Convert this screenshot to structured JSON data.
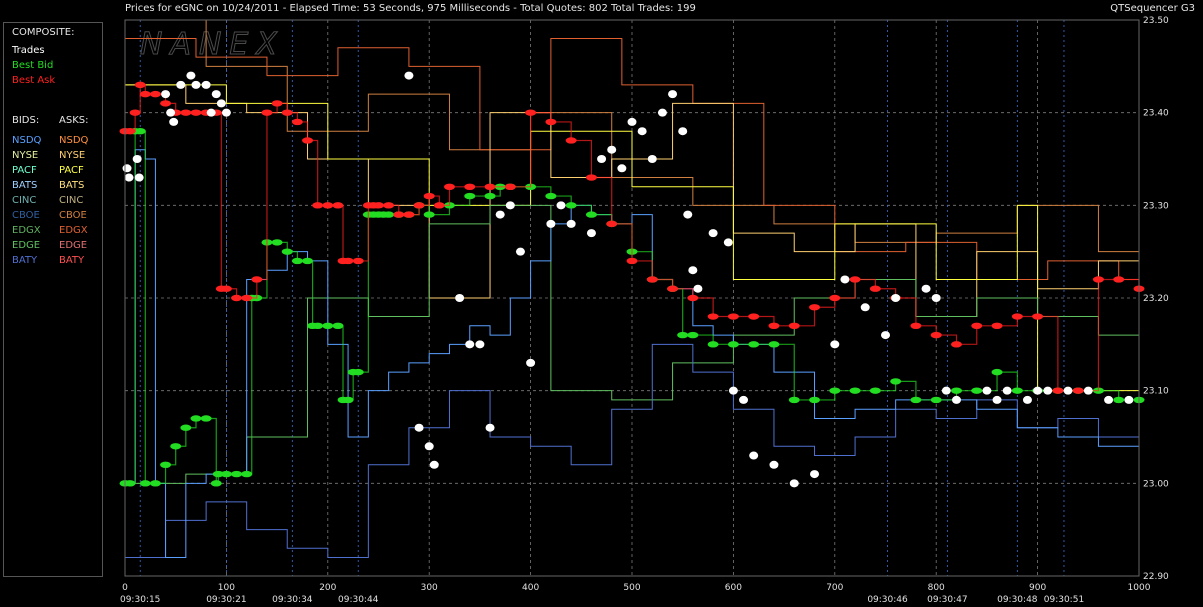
{
  "header": {
    "title": "Prices for  eGNC  on  10/24/2011  -  Elapsed Time: 53 Seconds, 975 Milliseconds  -  Total Quotes: 802  Total Trades: 199",
    "app_name": "QTSequencer G3",
    "watermark": "NANEX"
  },
  "legend": {
    "composite_title": "COMPOSITE:",
    "composite": [
      {
        "label": "Trades",
        "color": "#ffffff"
      },
      {
        "label": "Best Bid",
        "color": "#22dd22"
      },
      {
        "label": "Best Ask",
        "color": "#ff2020"
      }
    ],
    "bids_title": "BIDS:",
    "asks_title": "ASKS:",
    "bids": [
      {
        "label": "NSDQ",
        "color": "#5aa0ff"
      },
      {
        "label": "NYSE",
        "color": "#e0f0a0"
      },
      {
        "label": "PACF",
        "color": "#70ffd0"
      },
      {
        "label": "BATS",
        "color": "#a0d0ff"
      },
      {
        "label": "CINC",
        "color": "#70b0b0"
      },
      {
        "label": "CBOE",
        "color": "#3060a0"
      },
      {
        "label": "EDGX",
        "color": "#60b060"
      },
      {
        "label": "EDGE",
        "color": "#60c060"
      },
      {
        "label": "BATY",
        "color": "#5070d0"
      }
    ],
    "asks": [
      {
        "label": "NSDQ",
        "color": "#ff9040"
      },
      {
        "label": "NYSE",
        "color": "#ffd070"
      },
      {
        "label": "PACF",
        "color": "#ffff40"
      },
      {
        "label": "BATS",
        "color": "#ffe080"
      },
      {
        "label": "CINC",
        "color": "#c0b080"
      },
      {
        "label": "CBOE",
        "color": "#d08040"
      },
      {
        "label": "EDGX",
        "color": "#e06030"
      },
      {
        "label": "EDGE",
        "color": "#e07070"
      },
      {
        "label": "BATY",
        "color": "#ff5050"
      }
    ]
  },
  "chart_data": {
    "type": "line",
    "xlim": [
      0,
      1000
    ],
    "ylim": [
      22.9,
      23.5
    ],
    "x_ticks": [
      0,
      100,
      200,
      300,
      400,
      500,
      600,
      700,
      800,
      900,
      1000
    ],
    "y_ticks": [
      "23.50",
      "23.40",
      "23.30",
      "23.20",
      "23.10",
      "23.00",
      "22.90"
    ],
    "time_labels": [
      {
        "x": 15,
        "label": "09:30:15"
      },
      {
        "x": 100,
        "label": "09:30:21"
      },
      {
        "x": 165,
        "label": "09:30:34"
      },
      {
        "x": 230,
        "label": "09:30:44"
      },
      {
        "x": 752,
        "label": "09:30:46"
      },
      {
        "x": 811,
        "label": "09:30:47"
      },
      {
        "x": 880,
        "label": "09:30:48"
      },
      {
        "x": 926,
        "label": "09:30:51"
      }
    ],
    "series": [
      {
        "name": "Best Bid",
        "x": [
          0,
          5,
          10,
          15,
          20,
          30,
          40,
          50,
          60,
          70,
          80,
          90,
          92,
          100,
          110,
          120,
          125,
          130,
          140,
          150,
          160,
          170,
          180,
          185,
          190,
          200,
          210,
          215,
          220,
          225,
          230,
          240,
          245,
          250,
          255,
          260,
          270,
          280,
          290,
          300,
          320,
          340,
          360,
          370,
          380,
          400,
          420,
          440,
          460,
          480,
          500,
          520,
          540,
          550,
          560,
          580,
          600,
          620,
          640,
          660,
          680,
          700,
          720,
          740,
          760,
          780,
          800,
          820,
          840,
          860,
          880,
          900,
          920,
          940,
          960,
          980,
          1000
        ],
        "y": [
          23.0,
          23.0,
          23.38,
          23.38,
          23.0,
          23.0,
          23.02,
          23.04,
          23.06,
          23.07,
          23.07,
          23.0,
          23.01,
          23.01,
          23.01,
          23.01,
          23.2,
          23.2,
          23.26,
          23.26,
          23.25,
          23.24,
          23.24,
          23.17,
          23.17,
          23.17,
          23.17,
          23.09,
          23.09,
          23.12,
          23.12,
          23.29,
          23.29,
          23.29,
          23.29,
          23.29,
          23.29,
          23.29,
          23.3,
          23.29,
          23.3,
          23.31,
          23.31,
          23.32,
          23.32,
          23.32,
          23.31,
          23.3,
          23.29,
          23.28,
          23.25,
          23.22,
          23.21,
          23.16,
          23.16,
          23.15,
          23.15,
          23.15,
          23.15,
          23.09,
          23.09,
          23.1,
          23.1,
          23.1,
          23.11,
          23.09,
          23.09,
          23.1,
          23.1,
          23.12,
          23.1,
          23.1,
          23.1,
          23.1,
          23.1,
          23.09,
          23.09
        ]
      },
      {
        "name": "Best Ask",
        "x": [
          0,
          5,
          10,
          15,
          20,
          30,
          40,
          50,
          60,
          70,
          80,
          90,
          95,
          100,
          110,
          120,
          130,
          140,
          150,
          160,
          170,
          180,
          190,
          200,
          210,
          215,
          220,
          230,
          240,
          245,
          250,
          260,
          270,
          280,
          290,
          300,
          310,
          320,
          340,
          360,
          380,
          400,
          420,
          440,
          460,
          480,
          500,
          520,
          540,
          560,
          580,
          600,
          620,
          640,
          660,
          680,
          700,
          720,
          740,
          760,
          780,
          800,
          820,
          840,
          860,
          880,
          900,
          920,
          940,
          960,
          980,
          1000
        ],
        "y": [
          23.38,
          23.38,
          23.4,
          23.43,
          23.42,
          23.42,
          23.41,
          23.4,
          23.4,
          23.4,
          23.4,
          23.4,
          23.21,
          23.21,
          23.2,
          23.2,
          23.22,
          23.4,
          23.41,
          23.4,
          23.39,
          23.37,
          23.3,
          23.3,
          23.3,
          23.24,
          23.24,
          23.24,
          23.3,
          23.3,
          23.3,
          23.3,
          23.29,
          23.29,
          23.3,
          23.31,
          23.3,
          23.32,
          23.32,
          23.32,
          23.32,
          23.4,
          23.39,
          23.37,
          23.33,
          23.28,
          23.24,
          23.22,
          23.21,
          23.2,
          23.18,
          23.18,
          23.18,
          23.17,
          23.17,
          23.19,
          23.2,
          23.22,
          23.21,
          23.2,
          23.17,
          23.16,
          23.15,
          23.17,
          23.17,
          23.18,
          23.18,
          23.1,
          23.1,
          23.22,
          23.22,
          23.21
        ]
      },
      {
        "name": "Trades",
        "x": [
          2,
          4,
          12,
          14,
          40,
          45,
          48,
          55,
          65,
          70,
          80,
          85,
          90,
          95,
          100,
          280,
          290,
          300,
          305,
          330,
          340,
          350,
          360,
          370,
          380,
          390,
          400,
          420,
          430,
          440,
          460,
          470,
          480,
          490,
          500,
          510,
          520,
          530,
          540,
          550,
          555,
          560,
          565,
          580,
          595,
          600,
          610,
          620,
          640,
          660,
          680,
          700,
          710,
          730,
          750,
          760,
          790,
          800,
          810,
          820,
          850,
          860,
          870,
          890,
          900,
          910,
          930,
          950,
          970,
          990
        ],
        "y": [
          23.34,
          23.33,
          23.35,
          23.33,
          23.42,
          23.4,
          23.39,
          23.43,
          23.44,
          23.43,
          23.43,
          23.4,
          23.42,
          23.41,
          23.4,
          23.44,
          23.06,
          23.04,
          23.02,
          23.2,
          23.15,
          23.15,
          23.06,
          23.29,
          23.3,
          23.25,
          23.13,
          23.28,
          23.3,
          23.28,
          23.27,
          23.35,
          23.36,
          23.34,
          23.39,
          23.38,
          23.35,
          23.4,
          23.42,
          23.38,
          23.29,
          23.23,
          23.21,
          23.27,
          23.26,
          23.1,
          23.09,
          23.03,
          23.02,
          23.0,
          23.01,
          23.15,
          23.22,
          23.19,
          23.16,
          23.2,
          23.21,
          23.2,
          23.1,
          23.09,
          23.1,
          23.09,
          23.1,
          23.09,
          23.1,
          23.1,
          23.1,
          23.1,
          23.09,
          23.09
        ]
      },
      {
        "name": "NSDQ",
        "x": [
          0,
          10,
          20,
          30,
          40,
          60,
          80,
          100,
          120,
          140,
          160,
          180,
          200,
          220,
          240,
          260,
          280,
          300,
          320,
          340,
          360,
          380,
          400,
          420,
          440,
          460,
          480,
          500,
          520,
          540,
          560,
          580,
          600,
          640,
          680,
          720,
          760,
          800,
          840,
          880,
          920,
          960,
          1000
        ],
        "y": [
          23.0,
          23.36,
          23.35,
          23.0,
          22.92,
          23.0,
          23.01,
          23.01,
          23.22,
          23.23,
          23.25,
          23.24,
          23.15,
          23.05,
          23.1,
          23.12,
          23.13,
          23.14,
          23.15,
          23.17,
          23.16,
          23.2,
          23.24,
          23.28,
          23.3,
          23.29,
          23.28,
          23.29,
          23.22,
          23.21,
          23.17,
          23.16,
          23.15,
          23.12,
          23.07,
          23.08,
          23.09,
          23.09,
          23.08,
          23.06,
          23.05,
          23.04,
          23.04
        ]
      },
      {
        "name": "BATY",
        "x": [
          0,
          40,
          80,
          120,
          160,
          200,
          240,
          280,
          320,
          360,
          400,
          440,
          480,
          520,
          560,
          600,
          640,
          680,
          720,
          760,
          800,
          840,
          880,
          920,
          960,
          1000
        ],
        "y": [
          22.92,
          22.96,
          22.98,
          22.95,
          22.93,
          22.92,
          23.02,
          23.06,
          23.1,
          23.05,
          23.04,
          23.02,
          23.08,
          23.15,
          23.12,
          23.08,
          23.04,
          23.03,
          23.05,
          23.08,
          23.07,
          23.09,
          23.06,
          23.07,
          23.05,
          23.03
        ]
      },
      {
        "name": "EDGE",
        "x": [
          0,
          60,
          120,
          180,
          240,
          300,
          360,
          420,
          480,
          540,
          600,
          660,
          720,
          780,
          840,
          900,
          960,
          1000
        ],
        "y": [
          23.0,
          23.01,
          23.05,
          23.2,
          23.18,
          23.28,
          23.3,
          23.1,
          23.09,
          23.13,
          23.16,
          23.2,
          23.22,
          23.18,
          23.2,
          23.18,
          23.16,
          23.18
        ]
      },
      {
        "name": "NYSE",
        "x": [
          0,
          60,
          120,
          180,
          240,
          300,
          360,
          420,
          480,
          540,
          600,
          660,
          720,
          780,
          840,
          900,
          960,
          1000
        ],
        "y": [
          23.43,
          23.41,
          23.4,
          23.35,
          23.3,
          23.2,
          23.4,
          23.33,
          23.35,
          23.41,
          23.27,
          23.25,
          23.28,
          23.18,
          23.25,
          23.21,
          23.24,
          23.2
        ]
      },
      {
        "name": "CBOE",
        "x": [
          0,
          80,
          160,
          240,
          320,
          400,
          480,
          560,
          640,
          720,
          800,
          880,
          960,
          1000
        ],
        "y": [
          23.5,
          23.45,
          23.38,
          23.42,
          23.36,
          23.4,
          23.33,
          23.3,
          23.28,
          23.26,
          23.27,
          23.3,
          23.25,
          23.27
        ]
      },
      {
        "name": "EDGX",
        "x": [
          0,
          70,
          140,
          210,
          280,
          350,
          420,
          490,
          560,
          630,
          700,
          770,
          840,
          910,
          980,
          1000
        ],
        "y": [
          23.48,
          23.46,
          23.44,
          23.47,
          23.45,
          23.36,
          23.48,
          23.43,
          23.41,
          23.3,
          23.25,
          23.26,
          23.22,
          23.24,
          23.22,
          23.23
        ]
      },
      {
        "name": "PACF",
        "x": [
          0,
          100,
          200,
          300,
          400,
          500,
          600,
          700,
          800,
          880,
          900,
          1000
        ],
        "y": [
          23.43,
          23.41,
          23.35,
          23.3,
          23.38,
          23.32,
          23.22,
          23.28,
          23.22,
          23.3,
          23.1,
          23.1
        ]
      }
    ]
  }
}
